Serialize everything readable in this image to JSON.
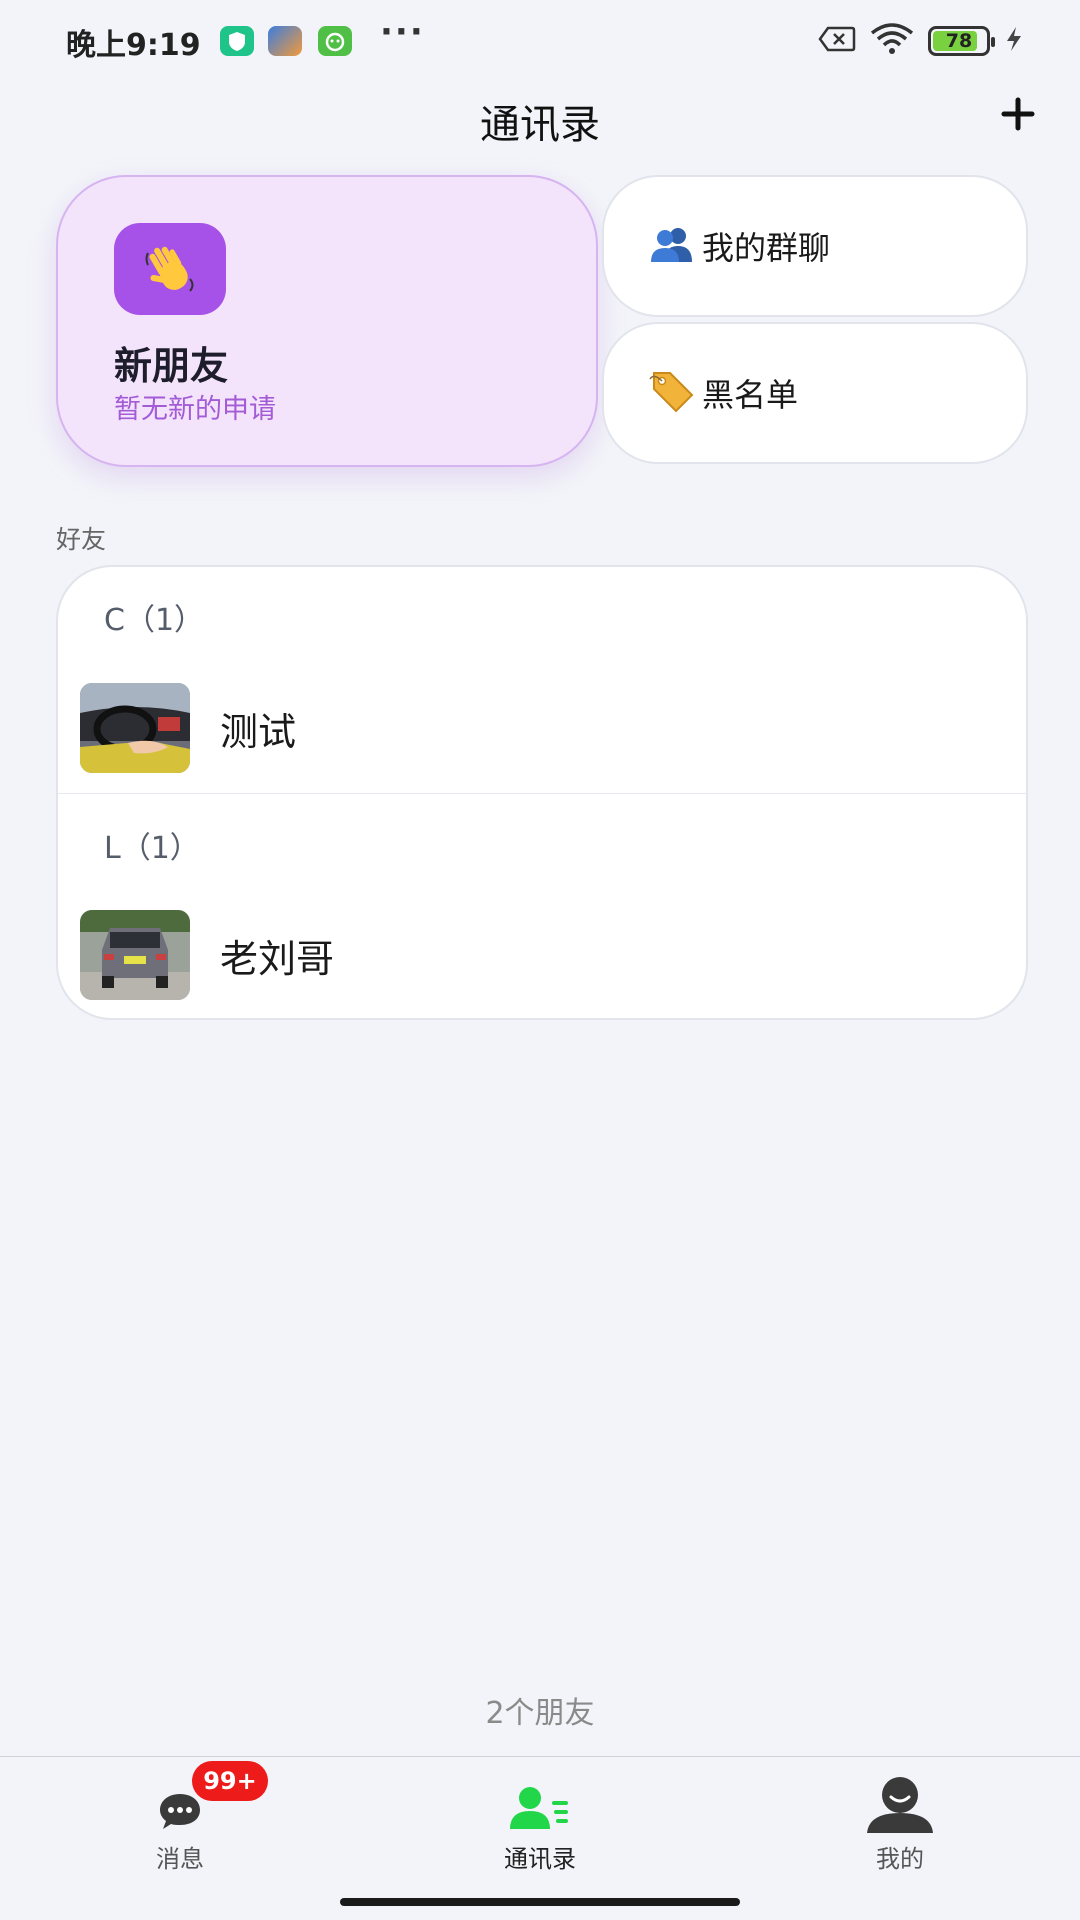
{
  "status_bar": {
    "time": "晚上9:19",
    "battery": "78"
  },
  "header": {
    "title": "通讯录",
    "add_icon": "plus-icon"
  },
  "cards": {
    "new_friends": {
      "title": "新朋友",
      "subtitle": "暂无新的申请",
      "icon": "waving-hand-icon"
    },
    "my_groups": {
      "label": "我的群聊",
      "icon": "people-icon"
    },
    "blacklist": {
      "label": "黑名单",
      "icon": "tag-icon"
    }
  },
  "friends": {
    "section_label": "好友",
    "groups": [
      {
        "header": "C（1）",
        "items": [
          {
            "name": "测试"
          }
        ]
      },
      {
        "header": "L（1）",
        "items": [
          {
            "name": "老刘哥"
          }
        ]
      }
    ],
    "count_text": "2个朋友"
  },
  "nav": {
    "items": [
      {
        "label": "消息",
        "badge": "99+",
        "icon": "chat-bubble-icon"
      },
      {
        "label": "通讯录",
        "icon": "contacts-icon",
        "active": true
      },
      {
        "label": "我的",
        "icon": "profile-icon"
      }
    ]
  },
  "colors": {
    "accent_purple": "#a652e8",
    "active_green": "#22d64a",
    "badge_red": "#ee1b1b"
  }
}
